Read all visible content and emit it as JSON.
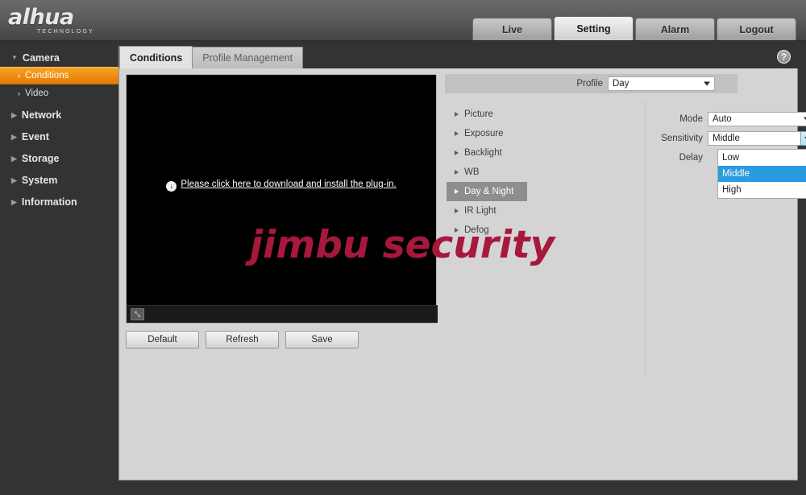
{
  "header": {
    "logo_main": "alhua",
    "logo_sub": "TECHNOLOGY",
    "nav": [
      {
        "label": "Live",
        "active": false
      },
      {
        "label": "Setting",
        "active": true
      },
      {
        "label": "Alarm",
        "active": false
      },
      {
        "label": "Logout",
        "active": false
      }
    ]
  },
  "sidebar": {
    "items": [
      {
        "label": "Camera",
        "level": 1,
        "expanded": true,
        "selected": false
      },
      {
        "label": "Conditions",
        "level": 2,
        "expanded": false,
        "selected": true
      },
      {
        "label": "Video",
        "level": 2,
        "expanded": false,
        "selected": false
      },
      {
        "label": "Network",
        "level": 1,
        "expanded": false,
        "selected": false
      },
      {
        "label": "Event",
        "level": 1,
        "expanded": false,
        "selected": false
      },
      {
        "label": "Storage",
        "level": 1,
        "expanded": false,
        "selected": false
      },
      {
        "label": "System",
        "level": 1,
        "expanded": false,
        "selected": false
      },
      {
        "label": "Information",
        "level": 1,
        "expanded": false,
        "selected": false
      }
    ]
  },
  "content": {
    "tabs": [
      {
        "label": "Conditions",
        "active": true
      },
      {
        "label": "Profile Management",
        "active": false
      }
    ],
    "help_icon": "?",
    "video": {
      "plugin_message": "Please click here to download and install the plug-in.",
      "download_icon": "↓",
      "fullscreen_icon": "⤡"
    },
    "buttons": [
      {
        "label": "Default"
      },
      {
        "label": "Refresh"
      },
      {
        "label": "Save"
      }
    ],
    "profile": {
      "label": "Profile",
      "value": "Day"
    },
    "submenu": [
      {
        "label": "Picture",
        "selected": false
      },
      {
        "label": "Exposure",
        "selected": false
      },
      {
        "label": "Backlight",
        "selected": false
      },
      {
        "label": "WB",
        "selected": false
      },
      {
        "label": "Day & Night",
        "selected": true
      },
      {
        "label": "IR Light",
        "selected": false
      },
      {
        "label": "Defog",
        "selected": false
      }
    ],
    "form": {
      "mode_label": "Mode",
      "mode_value": "Auto",
      "sensitivity_label": "Sensitivity",
      "sensitivity_value": "Middle",
      "delay_label": "Delay"
    },
    "dropdown_options": [
      {
        "label": "Low",
        "highlighted": false
      },
      {
        "label": "Middle",
        "highlighted": true
      },
      {
        "label": "High",
        "highlighted": false
      }
    ]
  },
  "watermark": {
    "text": "jimbu security"
  },
  "colors": {
    "accent_orange": "#ef8e12",
    "dropdown_highlight": "#2a9ae1",
    "watermark_red": "#a8183c",
    "panel_bg": "#d4d4d4",
    "page_bg": "#333333"
  }
}
